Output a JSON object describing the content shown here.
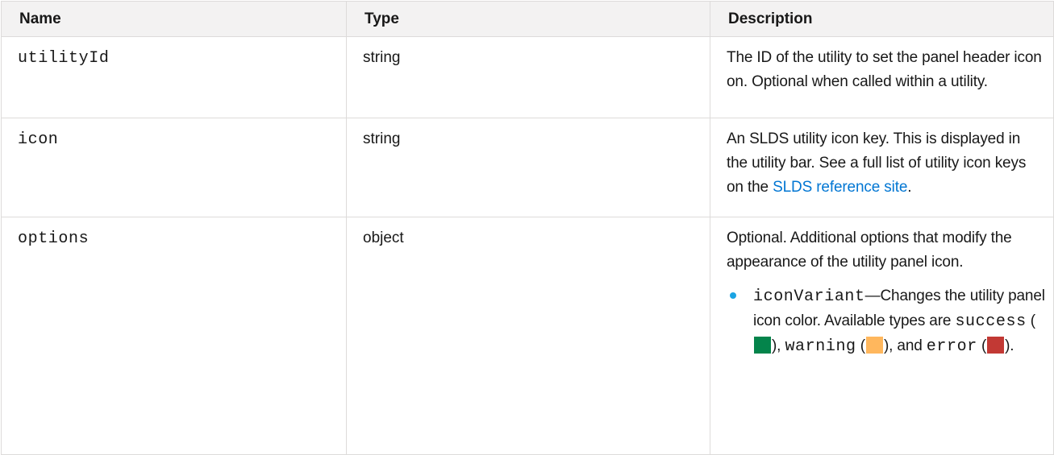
{
  "table": {
    "headers": {
      "name": "Name",
      "type": "Type",
      "description": "Description"
    },
    "rows": [
      {
        "name": "utilityId",
        "type": "string",
        "description": "The ID of the utility to set the panel header icon on. Optional when called within a utility."
      },
      {
        "name": "icon",
        "type": "string",
        "description_before_link": "An SLDS utility icon key. This is displayed in the utility bar. See a full list of utility icon keys on the ",
        "link_text": "SLDS reference site",
        "description_after_link": "."
      },
      {
        "name": "options",
        "type": "object",
        "description": "Optional. Additional options that modify the appearance of the utility panel icon.",
        "bullet": {
          "key": "iconVariant",
          "text": "—Changes the utility panel icon color. Available types are ",
          "variants": [
            {
              "name": "success",
              "color": "#04844b",
              "after": "), "
            },
            {
              "name": "warning",
              "color": "#ffb75d",
              "after": "), and "
            },
            {
              "name": "error",
              "color": "#c23934",
              "after": ")."
            }
          ]
        }
      }
    ]
  },
  "colors": {
    "header_bg": "#f3f2f2",
    "border": "#dddbda",
    "link": "#0176d3",
    "bullet": "#1ba4e3"
  }
}
